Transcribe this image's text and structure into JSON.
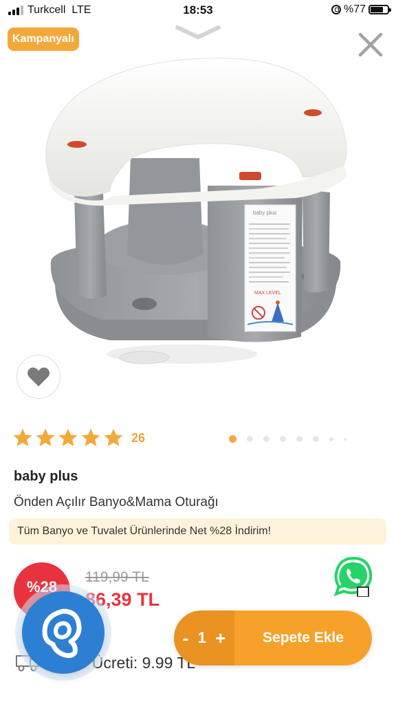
{
  "status_bar": {
    "carrier": "Turkcell",
    "network": "LTE",
    "time": "18:53",
    "battery": "%77",
    "battery_level": 0.77
  },
  "badge": {
    "label": "Kampanyalı"
  },
  "icons": {
    "drag": "chevron-down-icon",
    "close": "close-icon",
    "favorite": "heart-icon",
    "whatsapp": "whatsapp-icon",
    "shipping": "truck-icon",
    "brand_logo": "app-logo-icon"
  },
  "product": {
    "rating": 5,
    "review_count": "26",
    "image_count": 8,
    "active_image": 1,
    "brand": "baby plus",
    "title": "Önden Açılır Banyo&Mama Oturağı",
    "image_text": {
      "logo": "baby plus",
      "warning": "MAX LEVEL"
    }
  },
  "promo": {
    "text": "Tüm Banyo ve Tuvalet Ürünlerinde Net %28 İndirim!"
  },
  "pricing": {
    "discount": "%28",
    "old_price": "119,99 TL",
    "new_price": "86,39 TL"
  },
  "shipping": {
    "label": "Kargo Ücreti: 9.99 TL"
  },
  "cart": {
    "minus": "-",
    "quantity": "1",
    "plus": "+",
    "add_label": "Sepete Ekle"
  },
  "colors": {
    "accent": "#f3a93a",
    "cart": "#f6a22a",
    "cart_dark": "#ea9222",
    "sale": "#e8333e",
    "whatsapp": "#25d366",
    "brand_blue": "#2d7fd3",
    "promo_bg": "#fcf3da"
  }
}
